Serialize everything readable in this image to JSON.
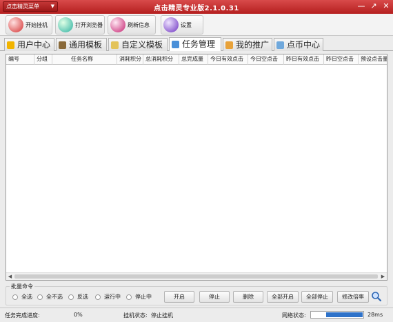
{
  "titlebar": {
    "menu_label": "点击精灵菜单",
    "title": "点击精灵专业版2.1.0.31",
    "min_glyph": "—",
    "max_glyph": "↗",
    "close_glyph": "✕"
  },
  "toolbar": {
    "start_label": "开始挂机",
    "browser_label": "打开浏览器",
    "refresh_label": "刷新信息",
    "settings_label": "设置"
  },
  "tabs": [
    {
      "label": "用户中心"
    },
    {
      "label": "通用模板"
    },
    {
      "label": "自定义模板"
    },
    {
      "label": "任务管理"
    },
    {
      "label": "我的推广"
    },
    {
      "label": "点币中心"
    }
  ],
  "active_tab": "任务管理",
  "grid": {
    "columns": [
      "编号",
      "分组",
      "任务名称",
      "消耗积分",
      "总消耗积分",
      "总完成量",
      "今日有效点击",
      "今日空点击",
      "昨日有效点击",
      "昨日空点击",
      "预设点击量"
    ],
    "rows": []
  },
  "batch": {
    "title": "批量命令",
    "radios": [
      "全选",
      "全不选",
      "反选",
      "运行中",
      "停止中"
    ],
    "buttons": [
      "开启",
      "停止",
      "删除",
      "全部开启",
      "全部停止",
      "修改倍率"
    ]
  },
  "status": {
    "progress_label": "任务完成进度:",
    "progress_value": "0%",
    "hang_label": "挂机状态:",
    "hang_value": "停止挂机",
    "net_label": "网络状态:",
    "net_latency": "28ms",
    "net_level": 0.7
  },
  "colors": {
    "title_bar": "#c62b2b",
    "net_fill": "#2e72c9"
  }
}
